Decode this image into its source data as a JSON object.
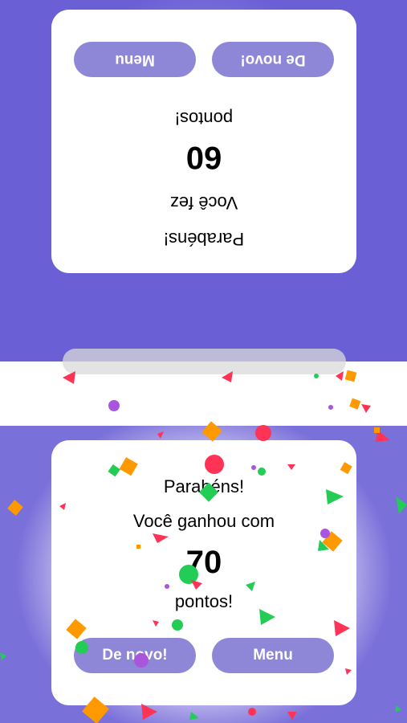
{
  "opponent": {
    "congrats": "Parabéns!",
    "message": "Você fez",
    "score": "60",
    "points_label": "pontos!",
    "again_label": "De novo!",
    "menu_label": "Menu"
  },
  "player": {
    "congrats": "Parabéns!",
    "message": "Você ganhou com",
    "score": "70",
    "points_label": "pontos!",
    "again_label": "De novo!",
    "menu_label": "Menu"
  },
  "colors": {
    "accent": "#6a5fd4",
    "button": "#8e86d6",
    "confetti": [
      "#ff3355",
      "#ff9900",
      "#22cc55",
      "#aa55dd"
    ]
  }
}
